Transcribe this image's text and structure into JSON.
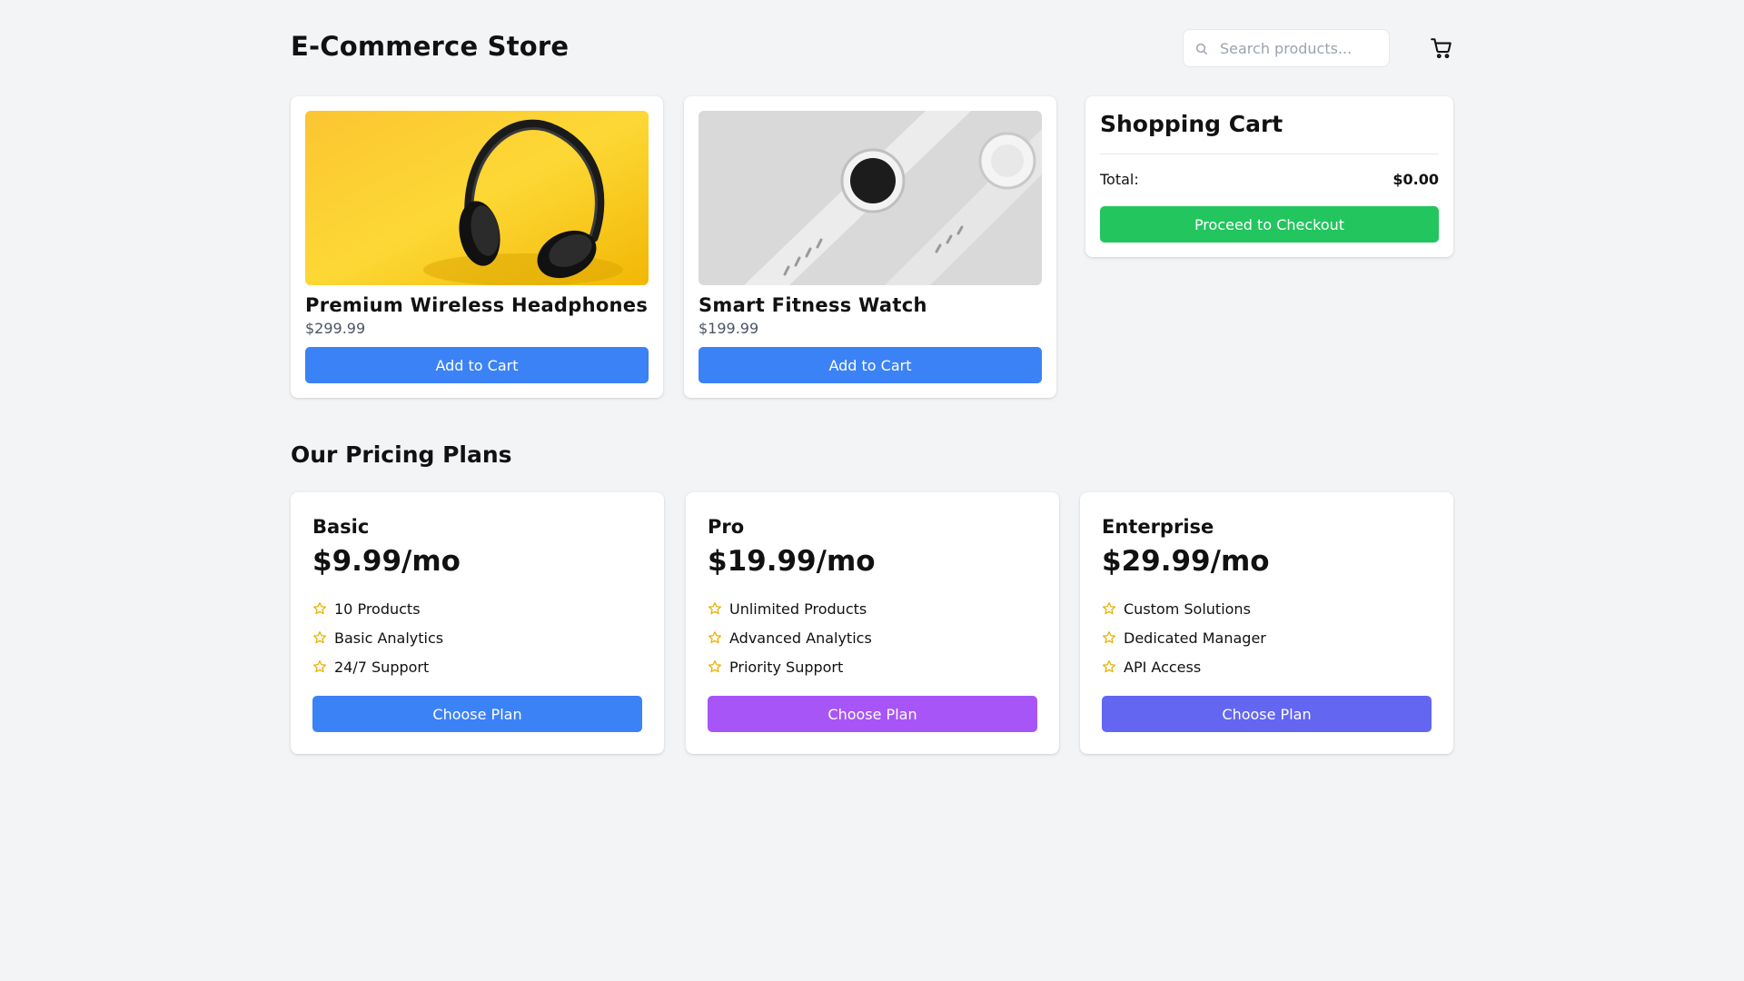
{
  "header": {
    "title": "E-Commerce Store",
    "search_placeholder": "Search products...",
    "search_value": "",
    "search_icon": "search-icon",
    "cart_icon": "shopping-cart-icon"
  },
  "products": [
    {
      "name": "Premium Wireless Headphones",
      "price": "$299.99",
      "button": "Add to Cart",
      "image": "headphones-photo"
    },
    {
      "name": "Smart Fitness Watch",
      "price": "$199.99",
      "button": "Add to Cart",
      "image": "smartwatch-photo"
    }
  ],
  "cart": {
    "title": "Shopping Cart",
    "total_label": "Total:",
    "total_value": "$0.00",
    "checkout_button": "Proceed to Checkout"
  },
  "pricing": {
    "title": "Our Pricing Plans",
    "plans": [
      {
        "name": "Basic",
        "price": "$9.99/mo",
        "features": [
          "10 Products",
          "Basic Analytics",
          "24/7 Support"
        ],
        "button": "Choose Plan",
        "button_color": "#3b82f6"
      },
      {
        "name": "Pro",
        "price": "$19.99/mo",
        "features": [
          "Unlimited Products",
          "Advanced Analytics",
          "Priority Support"
        ],
        "button": "Choose Plan",
        "button_color": "#a855f7"
      },
      {
        "name": "Enterprise",
        "price": "$29.99/mo",
        "features": [
          "Custom Solutions",
          "Dedicated Manager",
          "API Access"
        ],
        "button": "Choose Plan",
        "button_color": "#6366f1"
      }
    ],
    "feature_icon": "star-icon"
  },
  "colors": {
    "background": "#f3f4f6",
    "primary": "#3b82f6",
    "success": "#22c55e",
    "star": "#eab308"
  }
}
